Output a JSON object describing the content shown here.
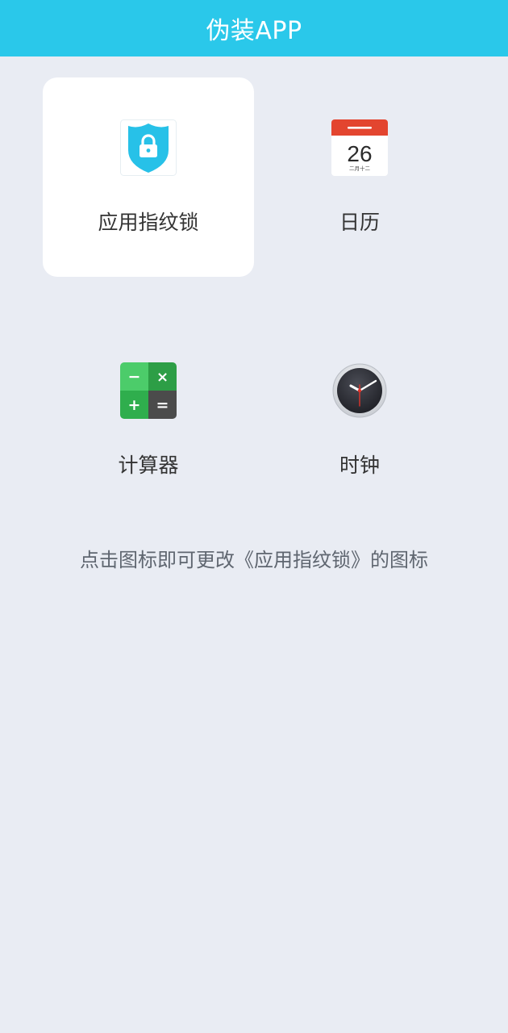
{
  "header": {
    "title": "伪装APP"
  },
  "colors": {
    "header_bg": "#2ac8ea",
    "page_bg": "#e9ecf3",
    "selected_tile_bg": "#ffffff"
  },
  "icons": [
    {
      "id": "fingerprint-lock",
      "label": "应用指纹锁",
      "icon": "shield-lock-icon",
      "selected": true
    },
    {
      "id": "calendar",
      "label": "日历",
      "icon": "calendar-icon",
      "selected": false,
      "day": "26",
      "lunar": "二月十二"
    },
    {
      "id": "calculator",
      "label": "计算器",
      "icon": "calculator-icon",
      "selected": false,
      "keys": [
        "−",
        "×",
        "+",
        "="
      ]
    },
    {
      "id": "clock",
      "label": "时钟",
      "icon": "clock-icon",
      "selected": false
    }
  ],
  "hint": "点击图标即可更改《应用指纹锁》的图标"
}
